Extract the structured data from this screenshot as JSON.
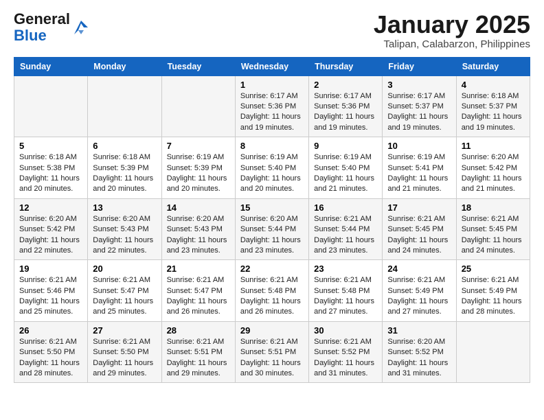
{
  "header": {
    "logo_line1": "General",
    "logo_line2": "Blue",
    "title": "January 2025",
    "subtitle": "Talipan, Calabarzon, Philippines"
  },
  "days_of_week": [
    "Sunday",
    "Monday",
    "Tuesday",
    "Wednesday",
    "Thursday",
    "Friday",
    "Saturday"
  ],
  "weeks": [
    [
      {
        "num": "",
        "info": ""
      },
      {
        "num": "",
        "info": ""
      },
      {
        "num": "",
        "info": ""
      },
      {
        "num": "1",
        "info": "Sunrise: 6:17 AM\nSunset: 5:36 PM\nDaylight: 11 hours and 19 minutes."
      },
      {
        "num": "2",
        "info": "Sunrise: 6:17 AM\nSunset: 5:36 PM\nDaylight: 11 hours and 19 minutes."
      },
      {
        "num": "3",
        "info": "Sunrise: 6:17 AM\nSunset: 5:37 PM\nDaylight: 11 hours and 19 minutes."
      },
      {
        "num": "4",
        "info": "Sunrise: 6:18 AM\nSunset: 5:37 PM\nDaylight: 11 hours and 19 minutes."
      }
    ],
    [
      {
        "num": "5",
        "info": "Sunrise: 6:18 AM\nSunset: 5:38 PM\nDaylight: 11 hours and 20 minutes."
      },
      {
        "num": "6",
        "info": "Sunrise: 6:18 AM\nSunset: 5:39 PM\nDaylight: 11 hours and 20 minutes."
      },
      {
        "num": "7",
        "info": "Sunrise: 6:19 AM\nSunset: 5:39 PM\nDaylight: 11 hours and 20 minutes."
      },
      {
        "num": "8",
        "info": "Sunrise: 6:19 AM\nSunset: 5:40 PM\nDaylight: 11 hours and 20 minutes."
      },
      {
        "num": "9",
        "info": "Sunrise: 6:19 AM\nSunset: 5:40 PM\nDaylight: 11 hours and 21 minutes."
      },
      {
        "num": "10",
        "info": "Sunrise: 6:19 AM\nSunset: 5:41 PM\nDaylight: 11 hours and 21 minutes."
      },
      {
        "num": "11",
        "info": "Sunrise: 6:20 AM\nSunset: 5:42 PM\nDaylight: 11 hours and 21 minutes."
      }
    ],
    [
      {
        "num": "12",
        "info": "Sunrise: 6:20 AM\nSunset: 5:42 PM\nDaylight: 11 hours and 22 minutes."
      },
      {
        "num": "13",
        "info": "Sunrise: 6:20 AM\nSunset: 5:43 PM\nDaylight: 11 hours and 22 minutes."
      },
      {
        "num": "14",
        "info": "Sunrise: 6:20 AM\nSunset: 5:43 PM\nDaylight: 11 hours and 23 minutes."
      },
      {
        "num": "15",
        "info": "Sunrise: 6:20 AM\nSunset: 5:44 PM\nDaylight: 11 hours and 23 minutes."
      },
      {
        "num": "16",
        "info": "Sunrise: 6:21 AM\nSunset: 5:44 PM\nDaylight: 11 hours and 23 minutes."
      },
      {
        "num": "17",
        "info": "Sunrise: 6:21 AM\nSunset: 5:45 PM\nDaylight: 11 hours and 24 minutes."
      },
      {
        "num": "18",
        "info": "Sunrise: 6:21 AM\nSunset: 5:45 PM\nDaylight: 11 hours and 24 minutes."
      }
    ],
    [
      {
        "num": "19",
        "info": "Sunrise: 6:21 AM\nSunset: 5:46 PM\nDaylight: 11 hours and 25 minutes."
      },
      {
        "num": "20",
        "info": "Sunrise: 6:21 AM\nSunset: 5:47 PM\nDaylight: 11 hours and 25 minutes."
      },
      {
        "num": "21",
        "info": "Sunrise: 6:21 AM\nSunset: 5:47 PM\nDaylight: 11 hours and 26 minutes."
      },
      {
        "num": "22",
        "info": "Sunrise: 6:21 AM\nSunset: 5:48 PM\nDaylight: 11 hours and 26 minutes."
      },
      {
        "num": "23",
        "info": "Sunrise: 6:21 AM\nSunset: 5:48 PM\nDaylight: 11 hours and 27 minutes."
      },
      {
        "num": "24",
        "info": "Sunrise: 6:21 AM\nSunset: 5:49 PM\nDaylight: 11 hours and 27 minutes."
      },
      {
        "num": "25",
        "info": "Sunrise: 6:21 AM\nSunset: 5:49 PM\nDaylight: 11 hours and 28 minutes."
      }
    ],
    [
      {
        "num": "26",
        "info": "Sunrise: 6:21 AM\nSunset: 5:50 PM\nDaylight: 11 hours and 28 minutes."
      },
      {
        "num": "27",
        "info": "Sunrise: 6:21 AM\nSunset: 5:50 PM\nDaylight: 11 hours and 29 minutes."
      },
      {
        "num": "28",
        "info": "Sunrise: 6:21 AM\nSunset: 5:51 PM\nDaylight: 11 hours and 29 minutes."
      },
      {
        "num": "29",
        "info": "Sunrise: 6:21 AM\nSunset: 5:51 PM\nDaylight: 11 hours and 30 minutes."
      },
      {
        "num": "30",
        "info": "Sunrise: 6:21 AM\nSunset: 5:52 PM\nDaylight: 11 hours and 31 minutes."
      },
      {
        "num": "31",
        "info": "Sunrise: 6:20 AM\nSunset: 5:52 PM\nDaylight: 11 hours and 31 minutes."
      },
      {
        "num": "",
        "info": ""
      }
    ]
  ]
}
